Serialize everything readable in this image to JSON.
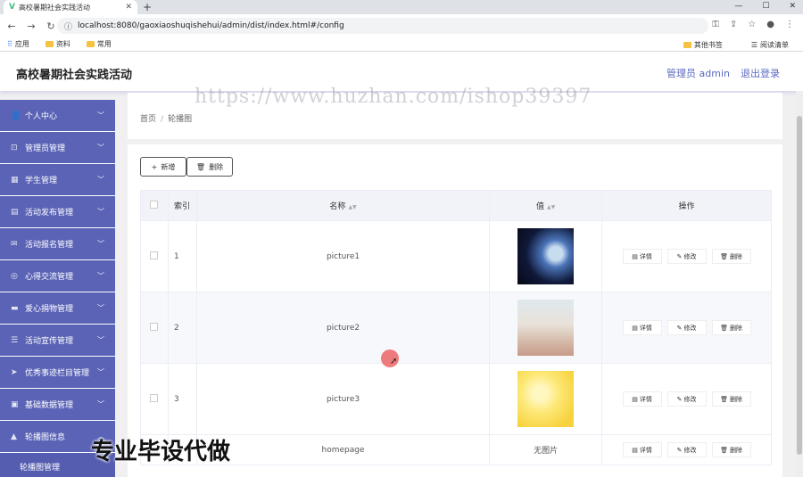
{
  "browser": {
    "tab_title": "高校暑期社会实践活动",
    "url": "localhost:8080/gaoxiaoshuqishehui/admin/dist/index.html#/config",
    "bookmarks": [
      "应用",
      "资料",
      "常用"
    ],
    "bookmarks_right": [
      "其他书签",
      "阅读清单"
    ]
  },
  "header": {
    "title": "高校暑期社会实践活动",
    "admin_label": "管理员 admin",
    "logout": "退出登录"
  },
  "watermark": "https://www.huzhan.com/ishop39397",
  "promo_text": "专业毕设代做",
  "sidebar": {
    "items": [
      {
        "label": "个人中心",
        "icon": "user-icon"
      },
      {
        "label": "管理员管理",
        "icon": "admin-icon"
      },
      {
        "label": "学生管理",
        "icon": "grid-icon"
      },
      {
        "label": "活动发布管理",
        "icon": "doc-icon"
      },
      {
        "label": "活动报名管理",
        "icon": "mail-icon"
      },
      {
        "label": "心得交流管理",
        "icon": "compass-icon"
      },
      {
        "label": "爱心捐物管理",
        "icon": "gift-icon"
      },
      {
        "label": "活动宣传管理",
        "icon": "sliders-icon"
      },
      {
        "label": "优秀事迹栏目管理",
        "icon": "send-icon"
      },
      {
        "label": "基础数据管理",
        "icon": "data-icon"
      },
      {
        "label": "轮播图信息",
        "icon": "image-icon"
      }
    ],
    "sub_item": "轮播图管理"
  },
  "breadcrumb": [
    "首页",
    "轮播图"
  ],
  "toolbar": {
    "add_label": "新增",
    "delete_label": "删除"
  },
  "table": {
    "headers": {
      "index": "索引",
      "name": "名称",
      "value": "值",
      "actions": "操作"
    },
    "rows": [
      {
        "index": "1",
        "name": "picture1",
        "thumb": "t1"
      },
      {
        "index": "2",
        "name": "picture2",
        "thumb": "t2"
      },
      {
        "index": "3",
        "name": "picture3",
        "thumb": "t3"
      },
      {
        "index": "",
        "name": "homepage",
        "value_text": "无图片"
      }
    ],
    "actions": {
      "detail": "详情",
      "edit": "修改",
      "delete": "删除"
    }
  }
}
